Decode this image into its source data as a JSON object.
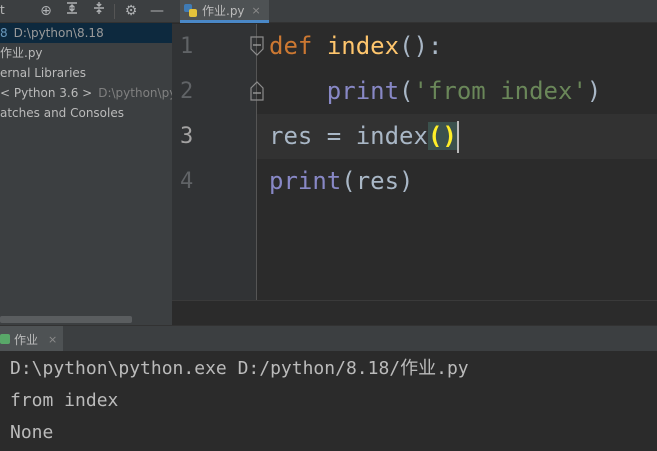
{
  "project_panel": {
    "toolbar_label": "t",
    "toolbar_icons": [
      "crosshair-icon",
      "collapse-all-icon",
      "expand-all-icon",
      "gear-icon",
      "minimize-icon"
    ],
    "tree": [
      {
        "prefix": "8",
        "name": "D:\\python\\8.18",
        "selected": true
      },
      {
        "name": "作业.py"
      },
      {
        "name": "ernal Libraries"
      },
      {
        "name": "< Python 3.6 >",
        "path": "D:\\python\\pyth"
      },
      {
        "name": "atches and Consoles"
      }
    ]
  },
  "editor": {
    "tab": {
      "label": "作业.py",
      "close": "×"
    },
    "line_numbers": [
      "1",
      "2",
      "3",
      "4"
    ],
    "current_line": "3",
    "lines": [
      [
        {
          "t": "def",
          "c": "kw"
        },
        {
          "t": " ",
          "c": "plain"
        },
        {
          "t": "index",
          "c": "fn"
        },
        {
          "t": "():",
          "c": "plain"
        }
      ],
      [
        {
          "t": "    ",
          "c": "plain"
        },
        {
          "t": "print",
          "c": "builtin"
        },
        {
          "t": "(",
          "c": "plain"
        },
        {
          "t": "'from index'",
          "c": "str"
        },
        {
          "t": ")",
          "c": "plain"
        }
      ],
      [
        {
          "t": "res = index",
          "c": "plain"
        },
        {
          "t": "()",
          "c": "paren-match"
        }
      ],
      [
        {
          "t": "print",
          "c": "builtin"
        },
        {
          "t": "(res)",
          "c": "plain"
        }
      ]
    ]
  },
  "run": {
    "tab_label": "作业",
    "tab_close": "×",
    "output": [
      "D:\\python\\python.exe D:/python/8.18/作业.py",
      "from index",
      "None"
    ]
  },
  "colors": {
    "keyword": "#cc7832",
    "function": "#ffc66d",
    "builtin": "#8888c6",
    "string": "#6a8759",
    "text": "#a9b7c6"
  }
}
